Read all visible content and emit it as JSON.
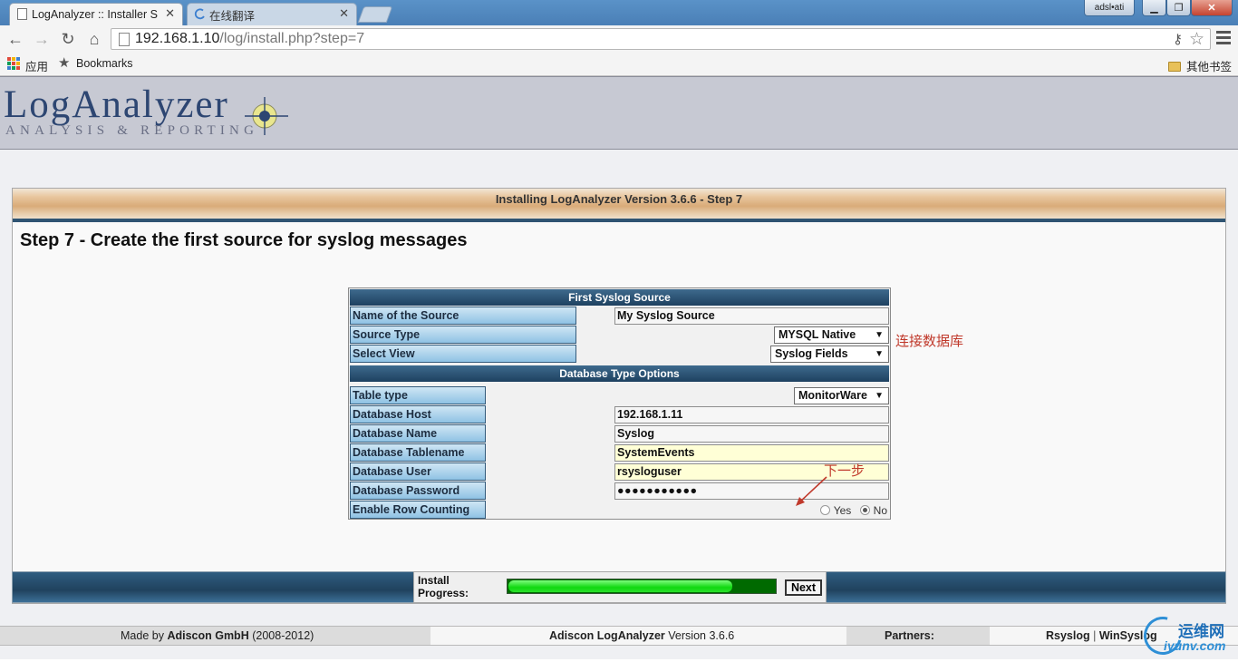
{
  "browser": {
    "tabs": [
      {
        "title": "LogAnalyzer :: Installer S",
        "active": true
      },
      {
        "title": "在线翻译",
        "active": false
      }
    ],
    "window_user": "adsl•ati",
    "url": {
      "host": "192.168.1.10",
      "path": "/log/install.php?step=7"
    },
    "bookmarks": {
      "apps": "应用",
      "bookmarks": "Bookmarks",
      "other": "其他书签"
    }
  },
  "logo": {
    "main": "LogAnalyzer",
    "sub": "ANALYSIS & REPORTING"
  },
  "step_header": "Installing LogAnalyzer Version 3.6.6 - Step 7",
  "step_title": "Step 7 - Create the first source for syslog messages",
  "form": {
    "section1_title": "First Syslog Source",
    "name_label": "Name of the Source",
    "name_value": "My Syslog Source",
    "source_type_label": "Source Type",
    "source_type_value": "MYSQL Native",
    "select_view_label": "Select View",
    "select_view_value": "Syslog Fields",
    "section2_title": "Database Type Options",
    "table_type_label": "Table type",
    "table_type_value": "MonitorWare",
    "db_host_label": "Database Host",
    "db_host_value": "192.168.1.11",
    "db_name_label": "Database Name",
    "db_name_value": "Syslog",
    "db_table_label": "Database Tablename",
    "db_table_value": "SystemEvents",
    "db_user_label": "Database User",
    "db_user_value": "rsysloguser",
    "db_pass_label": "Database Password",
    "db_pass_value": "●●●●●●●●●●●",
    "row_count_label": "Enable Row Counting",
    "yes_label": "Yes",
    "no_label": "No",
    "row_count_selected": "No"
  },
  "annotations": {
    "connect_db": "连接数据库",
    "next_step": "下一步"
  },
  "progress": {
    "label_line1": "Install",
    "label_line2": "Progress:",
    "fraction": 0.84,
    "next_label": "Next"
  },
  "footer": {
    "made_by_prefix": "Made by",
    "made_by_company": "Adiscon GmbH",
    "made_by_years": "(2008-2012)",
    "product_name": "Adiscon LogAnalyzer",
    "product_version": "Version 3.6.6",
    "partners_label": "Partners:",
    "partner1": "Rsyslog",
    "separator": "|",
    "partner2": "WinSyslog"
  },
  "watermark": {
    "top": "运维网",
    "bottom": "iyunv.com"
  },
  "colors": {
    "accent_blue": "#2f5472",
    "label_blue": "#8fc2e4",
    "progress_green": "#10d810",
    "annotation_red": "#c0392b"
  }
}
